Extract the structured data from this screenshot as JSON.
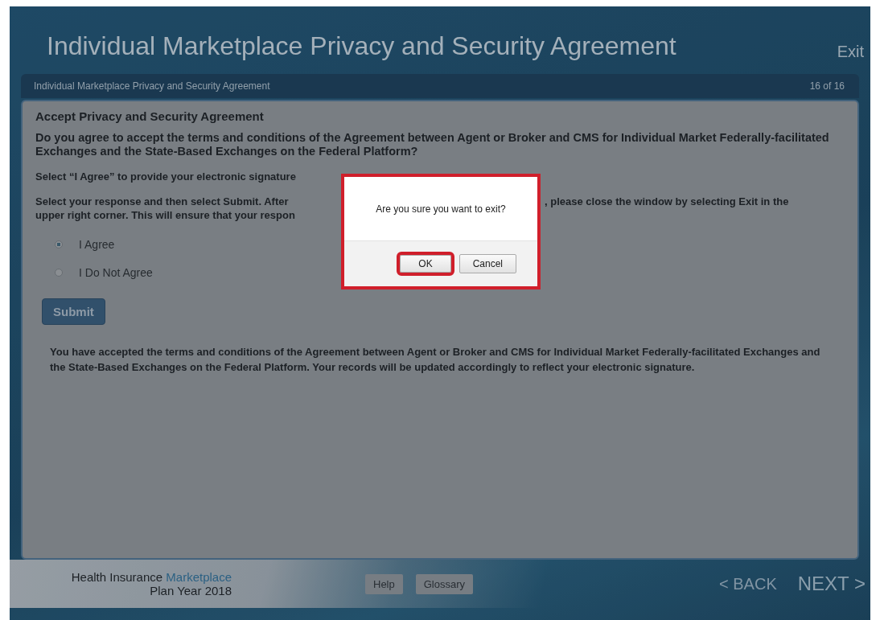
{
  "window": {
    "title": "Individual Marketplace Privacy and Security Agreement",
    "exit": "Exit"
  },
  "breadcrumb": {
    "title": "Individual Marketplace Privacy and Security Agreement",
    "progress": "16 of 16"
  },
  "content": {
    "heading": "Accept Privacy and Security Agreement",
    "question": "Do you agree to accept the terms and conditions of the Agreement between Agent or Broker and CMS for Individual Market Federally-facilitated Exchanges and the State-Based Exchanges on the Federal Platform?",
    "instruction_1": "Select “I Agree” to provide your electronic signature",
    "instruction_2_left": "Select your response and then select **Submit**. After",
    "instruction_2_right": ", please close the window by selecting **Exit** in the",
    "instruction_3": "upper right corner. This will ensure that your respon",
    "options": [
      {
        "label": "I Agree",
        "selected": true
      },
      {
        "label": "I Do Not Agree",
        "selected": false
      }
    ],
    "submit": "Submit",
    "confirmation": "You have accepted the terms and conditions of the Agreement between Agent or Broker and CMS for Individual Market Federally-facilitated Exchanges and the State-Based Exchanges on the Federal Platform. Your records will be updated accordingly to reflect your electronic signature."
  },
  "dialog": {
    "message": "Are you sure you want to exit?",
    "ok": "OK",
    "cancel": "Cancel"
  },
  "footer": {
    "brand_1": "Health Insurance ",
    "brand_2": "Marketplace",
    "plan_year": "Plan Year 2018",
    "help": "Help",
    "glossary": "Glossary",
    "back": "< BACK",
    "next": "NEXT >"
  }
}
